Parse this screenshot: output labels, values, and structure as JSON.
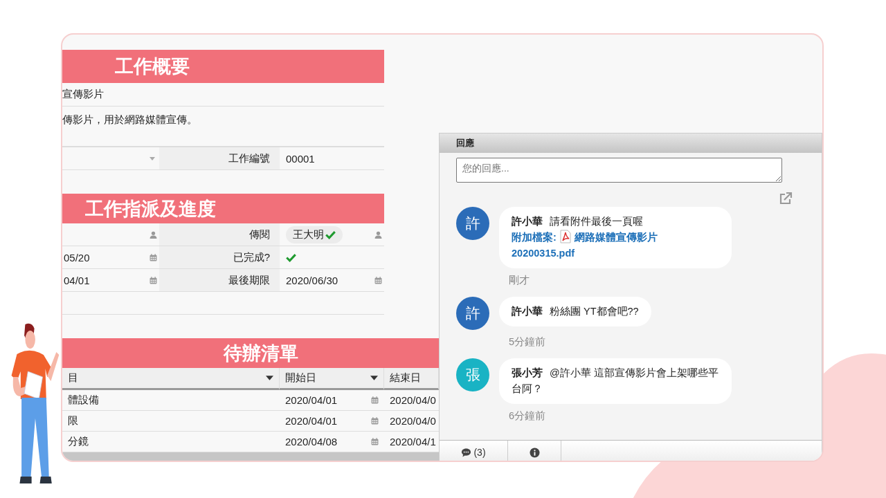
{
  "summary": {
    "title": "工作概要",
    "subject": "宣傳影片",
    "description": "傳影片，用於網路媒體宣傳。",
    "field_label": "工作編號",
    "field_value": "00001"
  },
  "assignment": {
    "title": "工作指派及進度",
    "rows": [
      {
        "left": {
          "kind": "person"
        },
        "label": "傳閱",
        "right": {
          "kind": "chip",
          "value": "王大明",
          "checked": true
        }
      },
      {
        "left": {
          "kind": "date",
          "value": "05/20"
        },
        "label": "已完成?",
        "right": {
          "kind": "check",
          "checked": true
        }
      },
      {
        "left": {
          "kind": "date",
          "value": "04/01"
        },
        "label": "最後期限",
        "right": {
          "kind": "date",
          "value": "2020/06/30"
        }
      }
    ]
  },
  "todo": {
    "title": "待辦清單",
    "columns": [
      {
        "label": "目",
        "menu": true
      },
      {
        "label": "開始日",
        "menu": true
      },
      {
        "label": "結束日",
        "menu": false
      }
    ],
    "rows": [
      [
        "體設備",
        "2020/04/01",
        "2020/04/0"
      ],
      [
        "限",
        "2020/04/01",
        "2020/04/0"
      ],
      [
        "分鏡",
        "2020/04/08",
        "2020/04/1"
      ]
    ]
  },
  "chat": {
    "title": "回應",
    "placeholder": "您的回應...",
    "messages": [
      {
        "initial": "許",
        "color": "#2b6cb8",
        "author": "許小華",
        "text": "請看附件最後一頁喔",
        "attachment": {
          "label": "附加檔案:",
          "file": "網路媒體宣傳影片 20200315.pdf"
        },
        "time": "剛才"
      },
      {
        "initial": "許",
        "color": "#2b6cb8",
        "author": "許小華",
        "text": "粉絲團 YT都會吧??",
        "time": "5分鐘前"
      },
      {
        "initial": "張",
        "color": "#19b3c4",
        "author": "張小芳",
        "text": "@許小華 這部宣傳影片會上架哪些平台阿？",
        "time": "6分鐘前"
      }
    ],
    "tabs": [
      {
        "kind": "comments",
        "label": "(3)"
      },
      {
        "kind": "info"
      }
    ]
  }
}
